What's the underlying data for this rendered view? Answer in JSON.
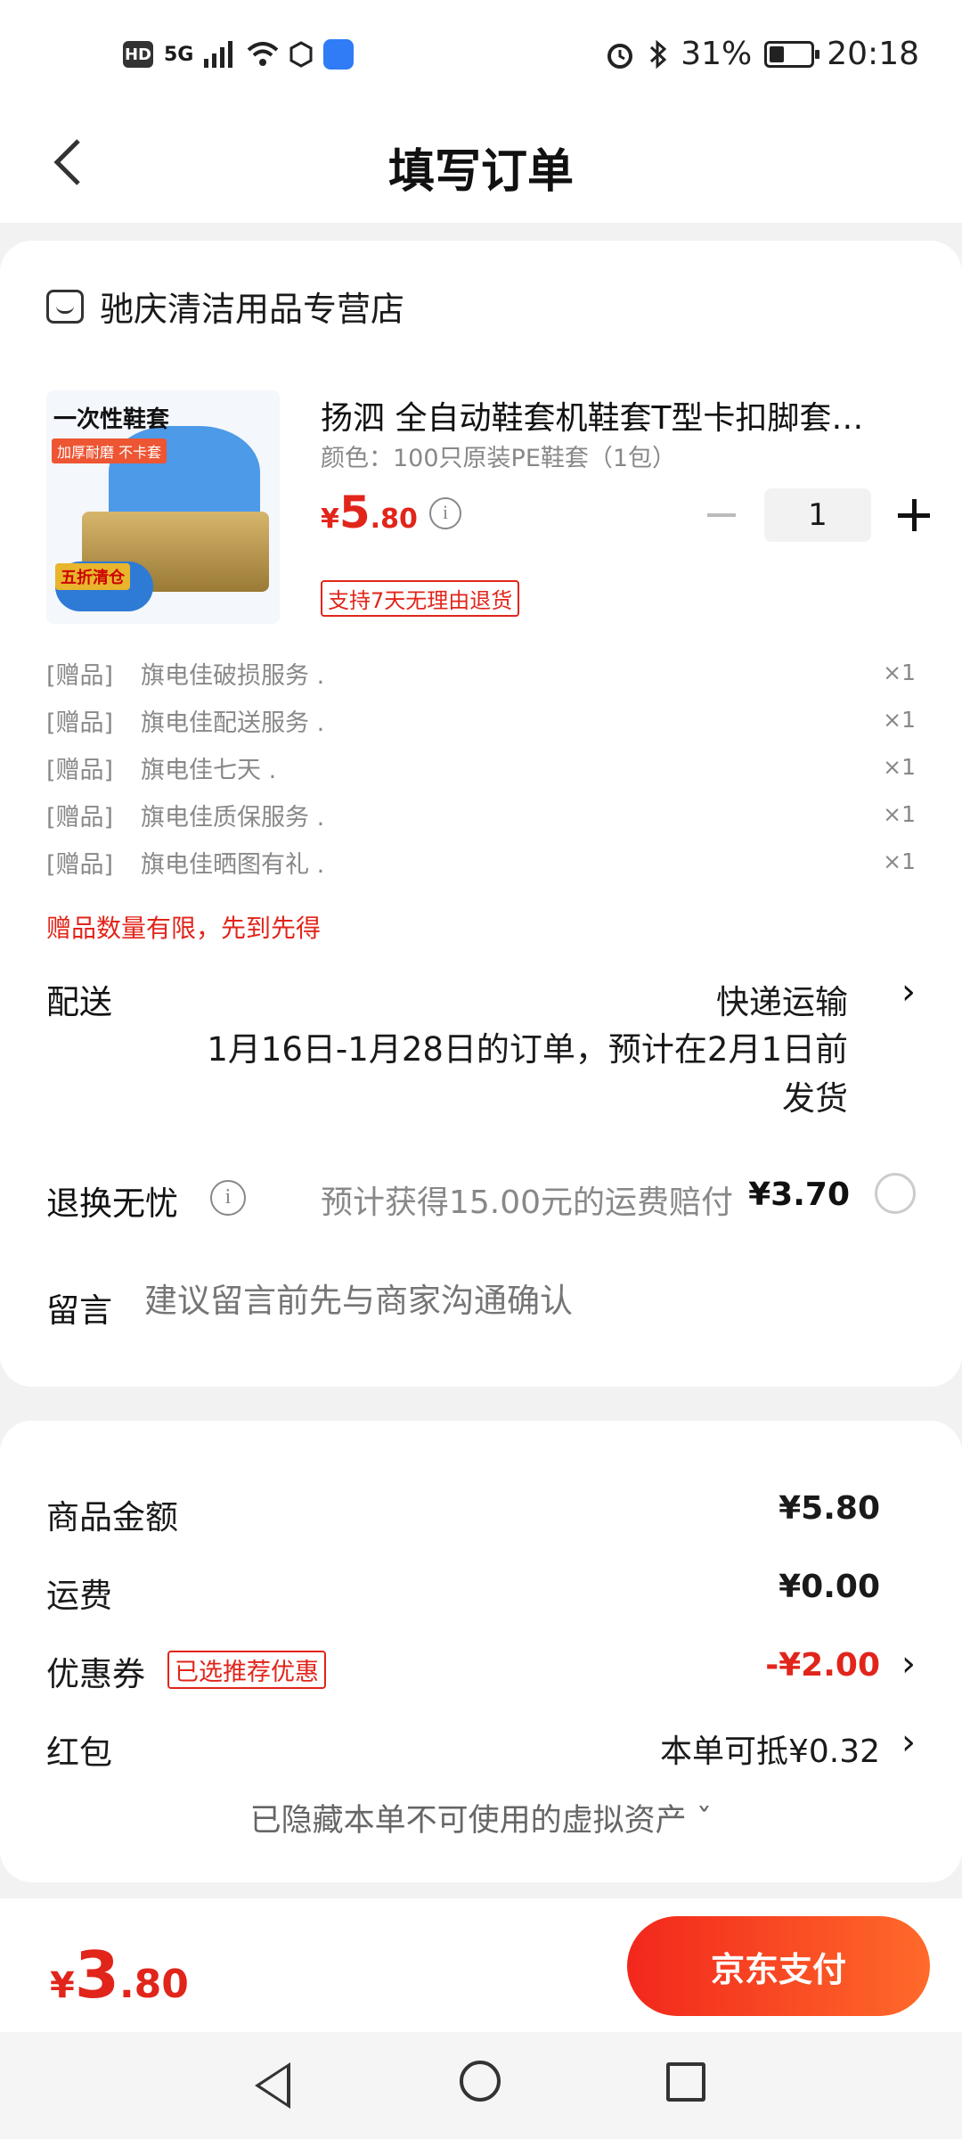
{
  "status": {
    "signal": "5G",
    "battery": "31%",
    "time": "20:18"
  },
  "header": {
    "title": "填写订单"
  },
  "store": {
    "name": "驰庆清洁用品专营店"
  },
  "product": {
    "image_text": "一次性鞋套",
    "image_subtext": "加厚耐磨 不卡套",
    "image_badge": "五折清仓",
    "title": "扬泗 全自动鞋套机鞋套T型卡扣脚套…",
    "spec": "颜色：100只原装PE鞋套（1包）",
    "price_currency": "¥",
    "price_int": "5",
    "price_dec": ".80",
    "quantity": "1",
    "return_policy": "支持7天无理由退货"
  },
  "gifts": [
    {
      "tag": "[赠品]",
      "name": "旗电佳破损服务 .",
      "qty": "×1"
    },
    {
      "tag": "[赠品]",
      "name": "旗电佳配送服务 .",
      "qty": "×1"
    },
    {
      "tag": "[赠品]",
      "name": "旗电佳七天 .",
      "qty": "×1"
    },
    {
      "tag": "[赠品]",
      "name": "旗电佳质保服务 .",
      "qty": "×1"
    },
    {
      "tag": "[赠品]",
      "name": "旗电佳晒图有礼 .",
      "qty": "×1"
    }
  ],
  "gift_note": "赠品数量有限，先到先得",
  "delivery": {
    "label": "配送",
    "method": "快递运输",
    "description": "1月16日-1月28日的订单，预计在2月1日前发货"
  },
  "worry_free": {
    "label": "退换无忧",
    "description": "预计获得15.00元的运费赔付",
    "price": "¥3.70"
  },
  "message": {
    "label": "留言",
    "placeholder": "建议留言前先与商家沟通确认"
  },
  "summary": {
    "goods_label": "商品金额",
    "goods_value": "¥5.80",
    "shipping_label": "运费",
    "shipping_value": "¥0.00",
    "coupon_label": "优惠券",
    "coupon_tag": "已选推荐优惠",
    "coupon_value": "-¥2.00",
    "redpacket_label": "红包",
    "redpacket_value": "本单可抵¥0.32",
    "hidden_assets": "已隐藏本单不可使用的虚拟资产 ˇ"
  },
  "paybar": {
    "total_currency": "¥",
    "total_int": "3",
    "total_dec": ".80",
    "pay_label": "京东支付"
  },
  "colors": {
    "accent": "#e1251b",
    "pay_gradient_start": "#f2271c",
    "pay_gradient_end": "#ff6a2a"
  }
}
